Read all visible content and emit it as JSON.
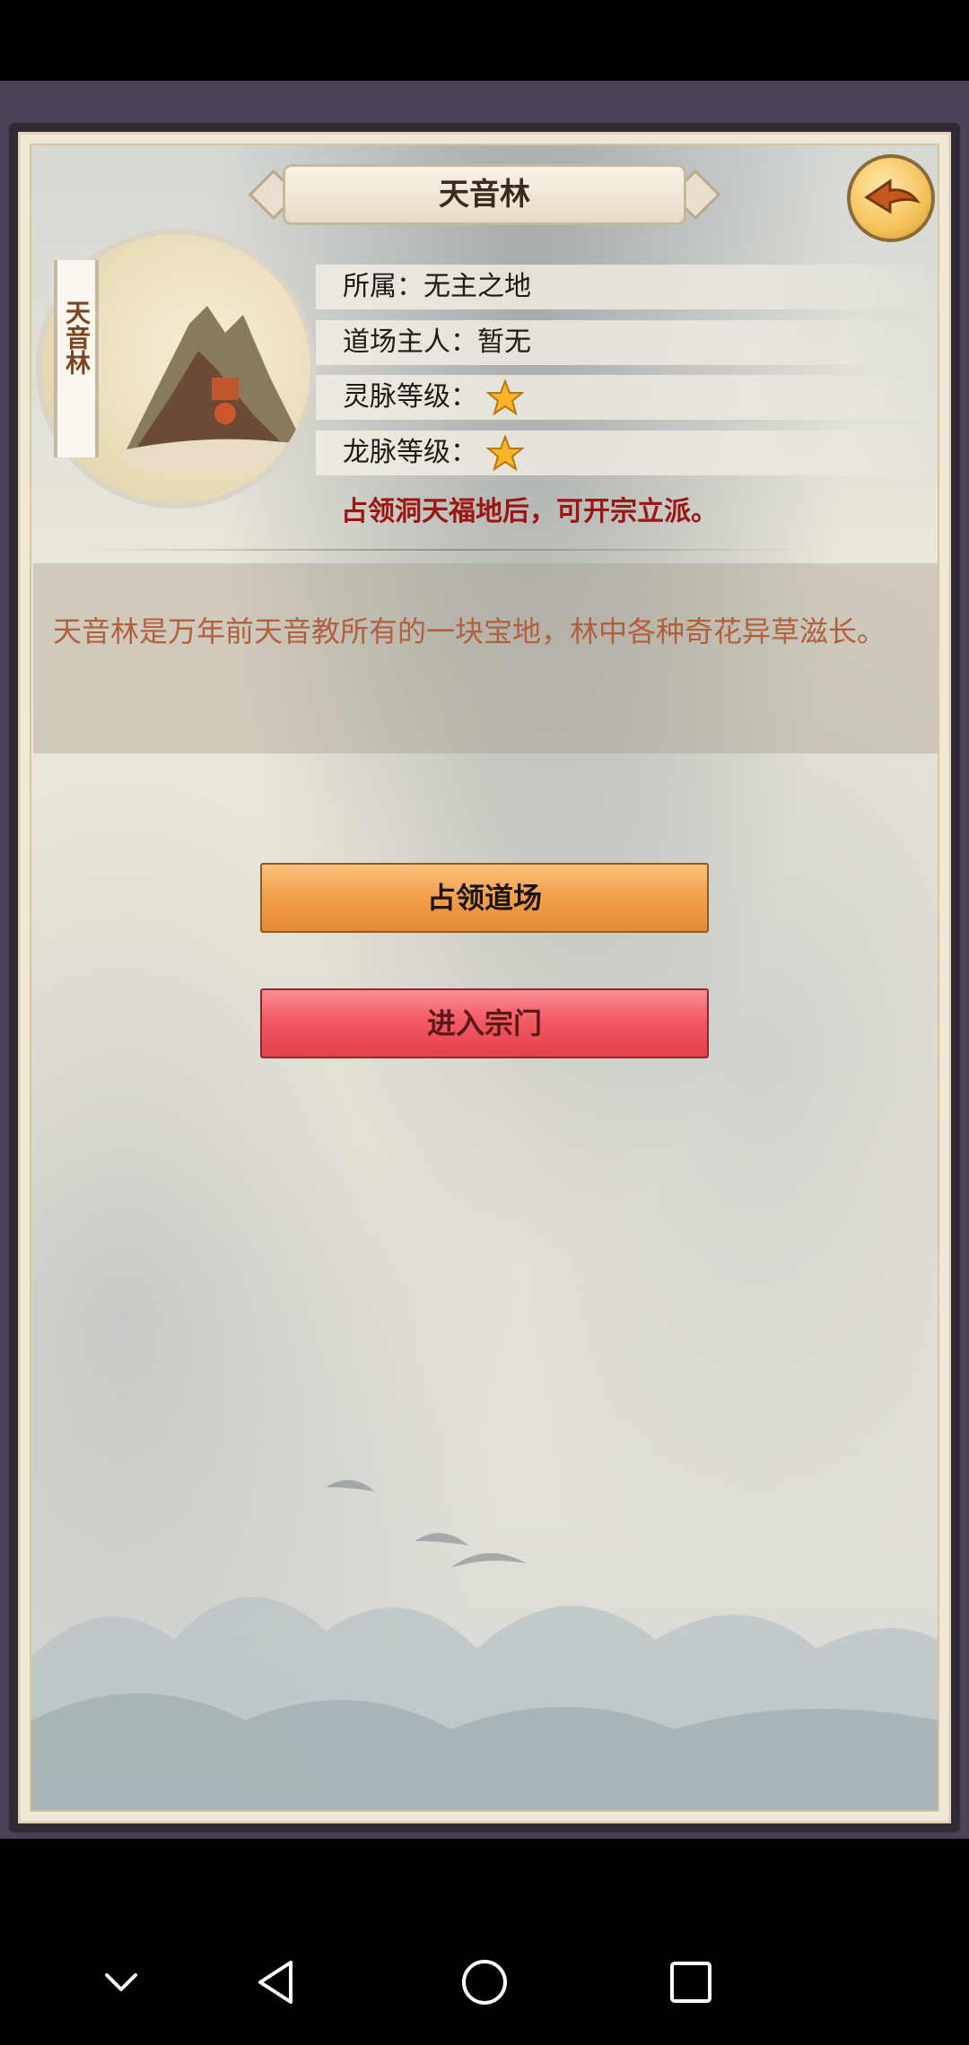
{
  "place": {
    "title": "天音林",
    "scroll_label": "天音林"
  },
  "info": {
    "affiliation": "所属：无主之地",
    "owner": "道场主人：暂无",
    "spirit_vein_label": "灵脉等级：",
    "spirit_vein_stars": 1,
    "dragon_vein_label": "龙脉等级：",
    "dragon_vein_stars": 1,
    "notice": "占领洞天福地后，可开宗立派。"
  },
  "description": "天音林是万年前天音教所有的一块宝地，林中各种奇花异草滋长。",
  "buttons": {
    "occupy": "占领道场",
    "enter_sect": "进入宗门"
  },
  "icons": {
    "back": "back-arrow-icon",
    "star": "star-icon",
    "nav_down": "chevron-down-icon",
    "nav_back": "triangle-back-icon",
    "nav_home": "circle-home-icon",
    "nav_recent": "square-recent-icon"
  },
  "colors": {
    "notice": "#9b1512",
    "description": "#b15f3c",
    "occupy_button": "#f2a24e",
    "enter_button": "#f15a64"
  }
}
